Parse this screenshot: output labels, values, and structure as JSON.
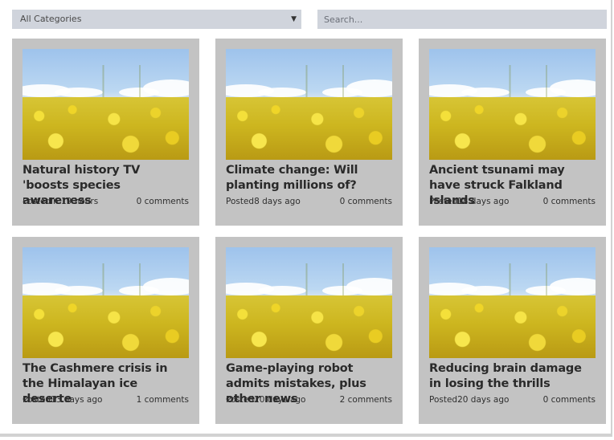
{
  "filters": {
    "category_selected": "All Categories",
    "search_placeholder": "Search..."
  },
  "posts": [
    {
      "title": "Natural history TV 'boosts species awareness",
      "posted": "Postedin 19 hours",
      "comments": "0 comments"
    },
    {
      "title": "Climate change: Will planting millions of?",
      "posted": "Posted8 days ago",
      "comments": "0 comments"
    },
    {
      "title": "Ancient tsunami may have struck Falkland Islands",
      "posted": "Posted18 days ago",
      "comments": "0 comments"
    },
    {
      "title": "The Cashmere crisis in the Himalayan ice deserte",
      "posted": "Posted13 days ago",
      "comments": "1 comments"
    },
    {
      "title": "Game-playing robot admits mistakes, plus other news",
      "posted": "Posted20 days ago",
      "comments": "2 comments"
    },
    {
      "title": "Reducing brain damage in losing the thrills",
      "posted": "Posted20 days ago",
      "comments": "0 comments"
    }
  ],
  "colors": {
    "card_background": "#c3c3c3",
    "control_background": "#d0d4dc"
  },
  "icons": {
    "dropdown": "dropdown-caret-icon",
    "thumbnail": "rapeseed-field-image"
  }
}
